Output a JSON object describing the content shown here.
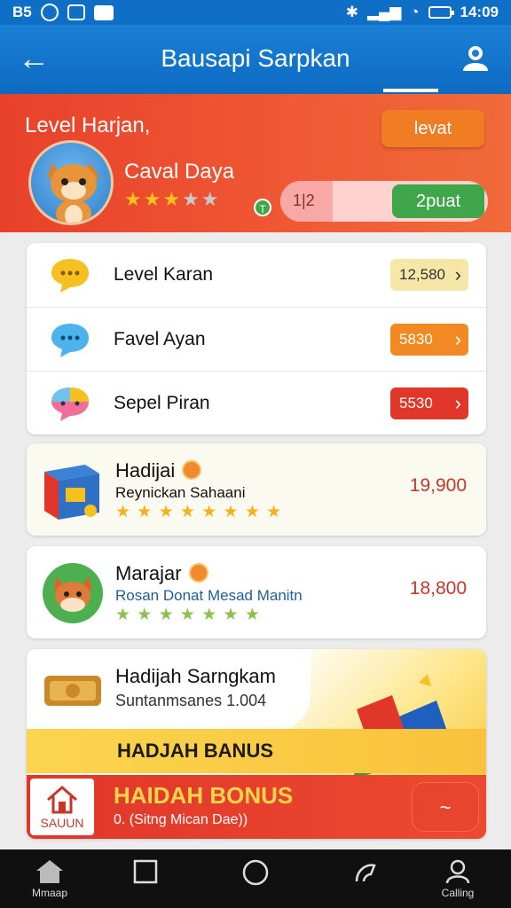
{
  "status_bar": {
    "left_text": "B5",
    "time": "14:09"
  },
  "app_bar": {
    "title": "Bausapi Sarpkan"
  },
  "level": {
    "label": "Level Harjan,",
    "name": "Caval Daya",
    "stars_filled": 3,
    "stars_total": 5,
    "top_button": "levat",
    "progress_value": "1|2",
    "progress_fraction": 0.25,
    "progress_button": "2puat",
    "badge": "T"
  },
  "menu": {
    "items": [
      {
        "label": "Level Karan",
        "value": "12,580",
        "color": "#f6e6a8",
        "text_color": "#333333"
      },
      {
        "label": "Favel Ayan",
        "value": "5830",
        "color": "#f28a24",
        "text_color": "#ffffff"
      },
      {
        "label": "Sepel Piran",
        "value": "5530",
        "color": "#e0372a",
        "text_color": "#ffffff"
      }
    ]
  },
  "gifts": [
    {
      "title": "Hadijai",
      "subtitle": "Reynickan Sahaani",
      "price": "19,900",
      "stars": "★ ★ ★ ★ ★ ★ ★ ★"
    },
    {
      "title": "Marajar",
      "subtitle": "Rosan Donat Mesad Manitn",
      "price": "18,800",
      "stars": "★ ★ ★ ★ ★ ★ ★"
    }
  ],
  "bonus": {
    "title": "Hadijah Sarngkam",
    "subtitle": "Suntanmsanes 1.004",
    "strip_title": "HADJAH BANUS",
    "bar_title": "HAIDAH BONUS",
    "bar_subtitle": "0. (Sitng Mican Dae))",
    "home_label": "SAUUN",
    "action_label": "~"
  },
  "nav": {
    "home_label": "Mmaap",
    "profile_label": "Calling"
  },
  "colors": {
    "primary": "#0f6fc6",
    "accent": "#e8412b",
    "gold": "#ffc21c"
  }
}
